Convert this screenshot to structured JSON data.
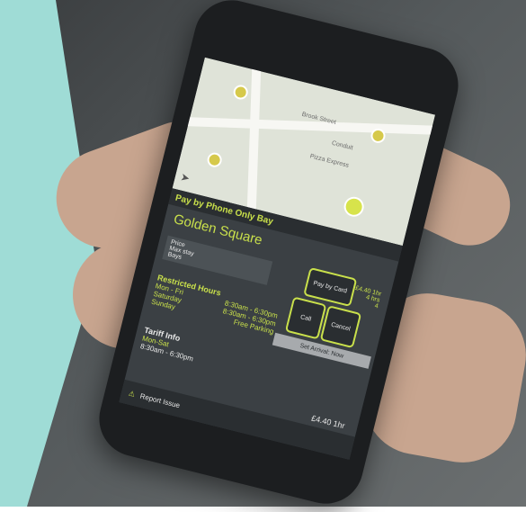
{
  "map": {
    "labels": [
      "Brook Street",
      "Conduit",
      "Pizza Express"
    ]
  },
  "parking": {
    "bay_type": "Pay by Phone Only Bay",
    "location": "Golden Square",
    "price_block": {
      "labels": [
        "Price",
        "Max stay",
        "Bays"
      ],
      "values": [
        "£4.40 1hr",
        "4 hrs",
        "4"
      ]
    },
    "restricted_hours": {
      "title": "Restricted Hours",
      "rows": [
        {
          "day": "Mon - Fri",
          "time": "8:30am - 6:30pm"
        },
        {
          "day": "Saturday",
          "time": "8:30am - 6:30pm"
        },
        {
          "day": "Sunday",
          "time": "Free Parking"
        }
      ]
    },
    "tariff": {
      "title": "Tariff Info",
      "days": "Mon-Sat",
      "hours": "8:30am - 6:30pm",
      "rate": "£4.40 1hr"
    },
    "actions": {
      "pay_by_card": "Pay by Card",
      "call": "Call",
      "cancel": "Cancel",
      "set_arrival": "Set Arrival: Now"
    },
    "report_issue": "Report Issue"
  }
}
